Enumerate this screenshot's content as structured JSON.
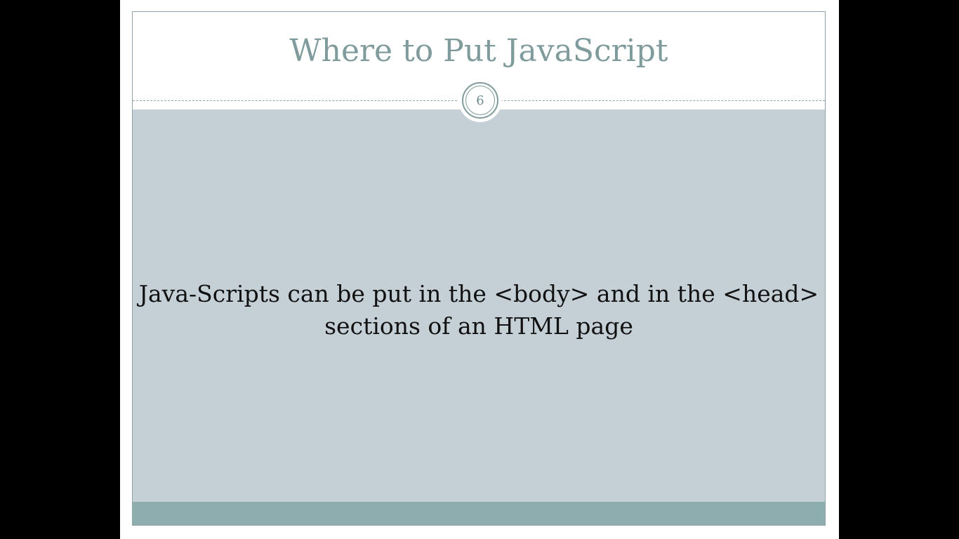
{
  "slide": {
    "title": "Where to Put JavaScript",
    "slide_number": "6",
    "body_line_1": "Java-Scripts can be put in the <body> and in the <head>",
    "body_line_2": "sections of an HTML page"
  },
  "colors": {
    "title": "#7f9b9c",
    "content_background": "#c5d0d6",
    "footer_band": "#8eadae",
    "frame_border": "#8fa3a6",
    "viewer_background": "#000000"
  }
}
